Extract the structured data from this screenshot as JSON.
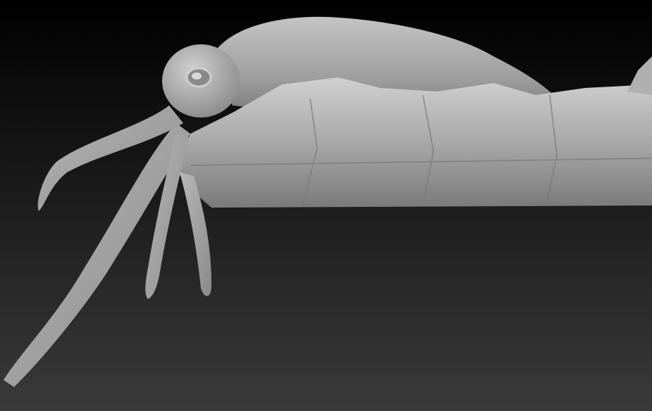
{
  "scene": {
    "subject": "sculpted-creature-on-rock",
    "colors": {
      "background_top": "#000000",
      "background_bottom": "#3a3a3a",
      "material_light": "#c8c8c8",
      "material_mid": "#9a9a9a",
      "material_dark": "#555555"
    }
  }
}
